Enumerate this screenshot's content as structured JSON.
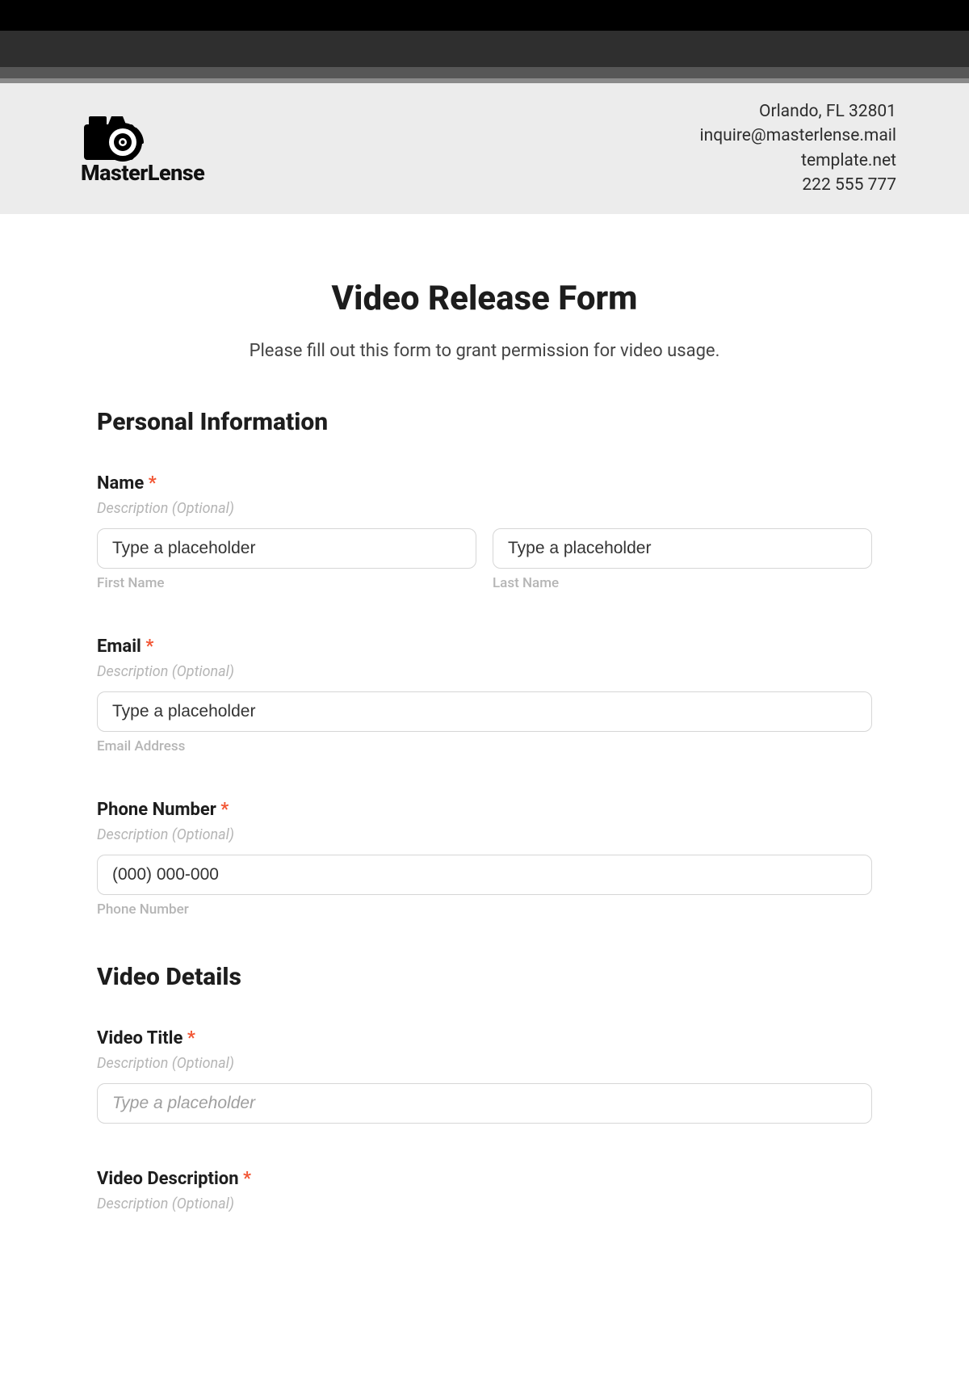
{
  "brand": {
    "name": "MasterLense",
    "contact": {
      "line1": "Orlando, FL 32801",
      "line2": "inquire@masterlense.mail",
      "line3": "template.net",
      "line4": "222 555 777"
    }
  },
  "form": {
    "title": "Video Release Form",
    "subtitle": "Please fill out this form to grant permission for video usage."
  },
  "section1": {
    "heading": "Personal Information",
    "name": {
      "label": "Name",
      "required": "*",
      "desc": "Description (Optional)",
      "first_placeholder": "Type a placeholder",
      "first_sub": "First Name",
      "last_placeholder": "Type a placeholder",
      "last_sub": "Last Name"
    },
    "email": {
      "label": "Email",
      "required": "*",
      "desc": "Description (Optional)",
      "placeholder": "Type a placeholder",
      "sub": "Email Address"
    },
    "phone": {
      "label": "Phone Number",
      "required": "*",
      "desc": "Description (Optional)",
      "placeholder": "(000) 000-000",
      "sub": "Phone Number"
    }
  },
  "section2": {
    "heading": "Video Details",
    "video_title": {
      "label": "Video Title",
      "required": "*",
      "desc": "Description (Optional)",
      "placeholder": "Type a placeholder"
    },
    "video_desc": {
      "label": "Video Description",
      "required": "*",
      "desc": "Description (Optional)"
    }
  }
}
